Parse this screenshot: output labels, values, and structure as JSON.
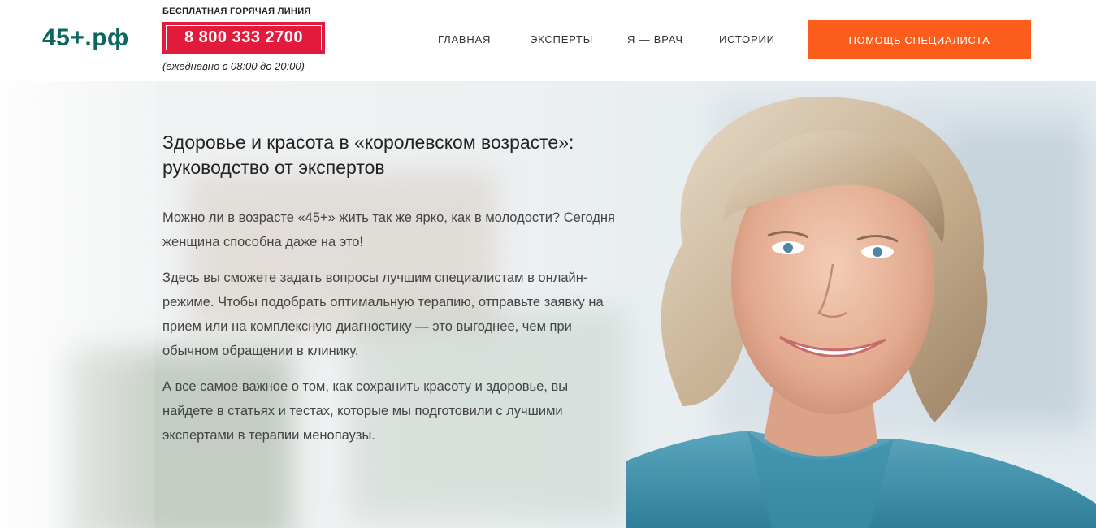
{
  "header": {
    "logo": "45+.рф",
    "hotline_label": "БЕСПЛАТНАЯ ГОРЯЧАЯ ЛИНИЯ",
    "phone": "8 800 333 2700",
    "hours": "(ежедневно с 08:00 до 20:00)",
    "nav": [
      {
        "label": "ГЛАВНАЯ"
      },
      {
        "label": "ЭКСПЕРТЫ"
      },
      {
        "label": "Я — ВРАЧ"
      },
      {
        "label": "ИСТОРИИ"
      }
    ],
    "cta_label": "ПОМОЩЬ СПЕЦИАЛИСТА"
  },
  "hero": {
    "title_line1": "Здоровье и красота в «королевском возрасте»:",
    "title_line2": "руководство от экспертов",
    "paragraphs": [
      "Можно ли в возрасте «45+» жить так же ярко, как в молодости? Сегодня женщина способна даже на это!",
      "Здесь вы сможете задать вопросы лучшим специалистам в онлайн-режиме. Чтобы подобрать оптимальную терапию, отправьте заявку на прием или на комплексную диагностику — это выгоднее, чем при обычном обращении в клинику.",
      "А все самое важное о том, как сохранить красоту и здоровье, вы найдете в статьях и тестах, которые мы подготовили с лучшими экспертами в терапии менопаузы."
    ],
    "image": "smiling-woman-photo"
  },
  "colors": {
    "logo": "#0d6660",
    "phone_bg": "#e21a3b",
    "cta_bg": "#fc5c1c"
  }
}
